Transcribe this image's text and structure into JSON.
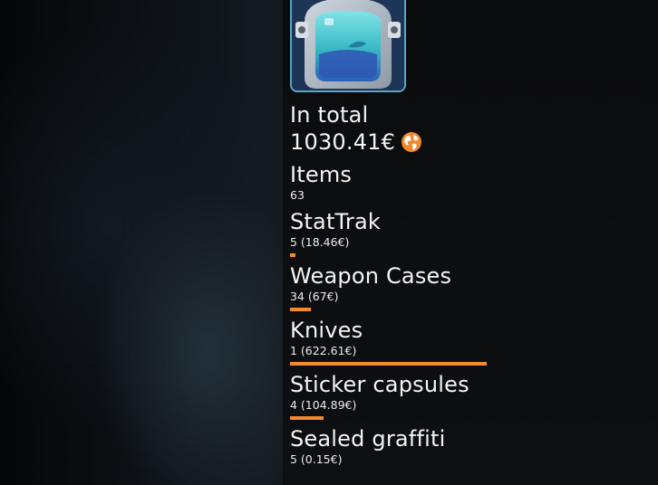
{
  "summary": {
    "total_label": "In total",
    "total_value": "1030.41€"
  },
  "colors": {
    "accent": "#f08a2c",
    "avatar_border": "#5aa6c3"
  },
  "stats": [
    {
      "title": "Items",
      "value": "63",
      "share": null
    },
    {
      "title": "StatTrak",
      "value": "5 (18.46€)",
      "share": 0.018
    },
    {
      "title": "Weapon Cases",
      "value": "34 (67€)",
      "share": 0.065
    },
    {
      "title": "Knives",
      "value": "1 (622.61€)",
      "share": 0.604
    },
    {
      "title": "Sticker capsules",
      "value": "4 (104.89€)",
      "share": 0.102
    },
    {
      "title": "Sealed graffiti",
      "value": "5 (0.15€)",
      "share": 0.0
    }
  ],
  "icons": {
    "globe": "globe-icon",
    "avatar": "astronaut-helmet-avatar"
  }
}
